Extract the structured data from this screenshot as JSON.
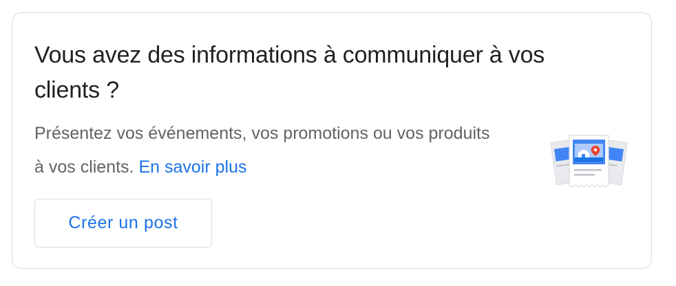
{
  "card": {
    "title": "Vous avez des informations à communiquer à vos clients ?",
    "description": "Présentez vos événements, vos promotions ou vos produits à vos clients.",
    "learn_more_link": "En savoir plus",
    "create_post_button": "Créer un post"
  },
  "illustration": {
    "icon": "posts-illustration-icon",
    "colors": {
      "blue": "#4285f4",
      "light_blue": "#aecbfa",
      "paper": "#ffffff",
      "paper_back": "#e8eaed",
      "lines": "#bdc1c6",
      "pin": "#ea4335"
    }
  },
  "colors": {
    "link": "#1a73e8",
    "title": "#202124",
    "body": "#5f6368",
    "border": "#dadce0"
  }
}
